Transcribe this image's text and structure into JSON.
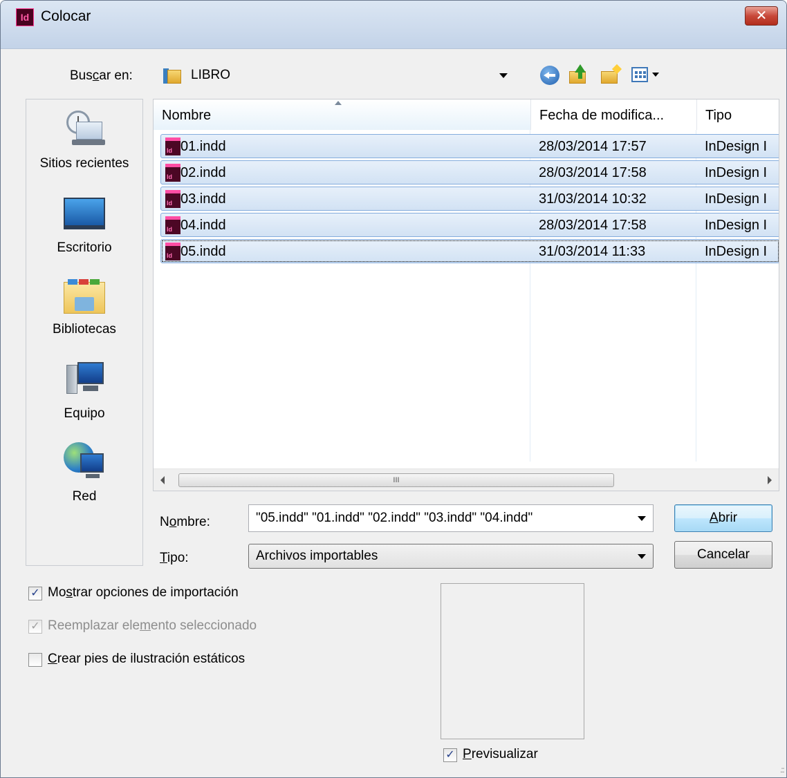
{
  "window": {
    "title": "Colocar",
    "app_icon": "Id",
    "close_glyph": "✕"
  },
  "lookin": {
    "label_pre": "Bus",
    "label_key": "c",
    "label_post": "ar en:",
    "value": "LIBRO"
  },
  "toolbar": {
    "icons": [
      "back-icon",
      "up-folder-icon",
      "new-folder-icon",
      "view-menu-icon"
    ]
  },
  "places": [
    {
      "label": "Sitios recientes",
      "icon": "recent-places-icon"
    },
    {
      "label": "Escritorio",
      "icon": "desktop-icon"
    },
    {
      "label": "Bibliotecas",
      "icon": "libraries-icon"
    },
    {
      "label": "Equipo",
      "icon": "computer-icon"
    },
    {
      "label": "Red",
      "icon": "network-icon"
    }
  ],
  "columns": {
    "name": "Nombre",
    "date": "Fecha de modifica...",
    "type": "Tipo"
  },
  "files": [
    {
      "name": "01.indd",
      "date": "28/03/2014 17:57",
      "type": "InDesign I"
    },
    {
      "name": "02.indd",
      "date": "28/03/2014 17:58",
      "type": "InDesign I"
    },
    {
      "name": "03.indd",
      "date": "31/03/2014 10:32",
      "type": "InDesign I"
    },
    {
      "name": "04.indd",
      "date": "28/03/2014 17:58",
      "type": "InDesign I"
    },
    {
      "name": "05.indd",
      "date": "31/03/2014 11:33",
      "type": "InDesign I"
    }
  ],
  "file_icon_glyph": "Id",
  "scrollbar": {
    "thumb_grip": "III"
  },
  "filename": {
    "label_pre": "N",
    "label_key": "o",
    "label_post": "mbre:",
    "value": "\"05.indd\" \"01.indd\" \"02.indd\" \"03.indd\" \"04.indd\""
  },
  "filetype": {
    "label_key": "T",
    "label_post": "ipo:",
    "value": "Archivos importables"
  },
  "buttons": {
    "open_key": "A",
    "open_post": "brir",
    "cancel": "Cancelar"
  },
  "options": {
    "show_import_pre": "Mo",
    "show_import_key": "s",
    "show_import_post": "trar opciones de importación",
    "replace_pre": "Reemplazar ele",
    "replace_key": "m",
    "replace_post": "ento seleccionado",
    "captions_key": "C",
    "captions_post": "rear pies de ilustración estáticos",
    "preview_key": "P",
    "preview_post": "revisualizar",
    "check_glyph": "✓"
  }
}
